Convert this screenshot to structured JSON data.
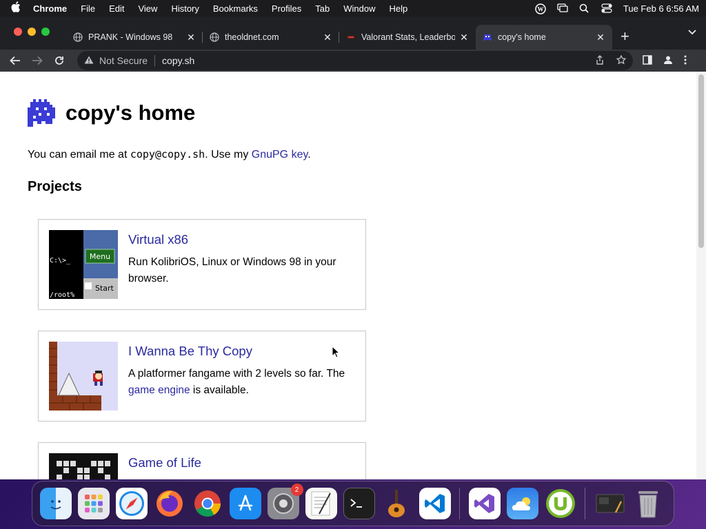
{
  "menubar": {
    "app": "Chrome",
    "items": [
      "File",
      "Edit",
      "View",
      "History",
      "Bookmarks",
      "Profiles",
      "Tab",
      "Window",
      "Help"
    ],
    "clock": "Tue Feb 6  6:56 AM"
  },
  "tabs": [
    {
      "title": "PRANK - Windows 98",
      "icon": "globe-icon"
    },
    {
      "title": "theoldnet.com",
      "icon": "globe-icon"
    },
    {
      "title": "Valorant Stats, Leaderbo",
      "icon": "tracker-icon"
    },
    {
      "title": "copy's home",
      "icon": "space-invader-icon",
      "active": true
    }
  ],
  "omnibox": {
    "security": "Not Secure",
    "url": "copy.sh"
  },
  "page": {
    "title": "copy's home",
    "email_prefix": "You can email me at ",
    "email": "copy@copy.sh",
    "email_mid": ". Use my ",
    "gpg_link": "GnuPG key",
    "email_suffix": ".",
    "projects_heading": "Projects",
    "projects": [
      {
        "title": "Virtual x86",
        "desc": "Run KolibriOS, Linux or Windows 98 in your browser.",
        "thumb_text": {
          "prompt": "C:\\>_",
          "root": "/root%",
          "menu": "Menu",
          "start": "Start"
        }
      },
      {
        "title": "I Wanna Be Thy Copy",
        "desc_before": "A platformer fangame with 2 levels so far. The ",
        "desc_link": "game engine",
        "desc_after": " is available."
      },
      {
        "title": "Game of Life"
      }
    ]
  },
  "dock": {
    "apps": [
      "Finder",
      "Launchpad",
      "Safari",
      "Firefox",
      "Chrome",
      "App Store",
      "System Settings",
      "TextEdit",
      "Terminal",
      "GarageBand",
      "VS Code",
      "Visual Studio",
      "Weather",
      "uTorrent",
      "Screenshot",
      "Trash"
    ],
    "settings_badge": "2"
  },
  "colors": {
    "link": "#2a2aa0",
    "tabbar": "#202124",
    "toolbar": "#35363a"
  }
}
